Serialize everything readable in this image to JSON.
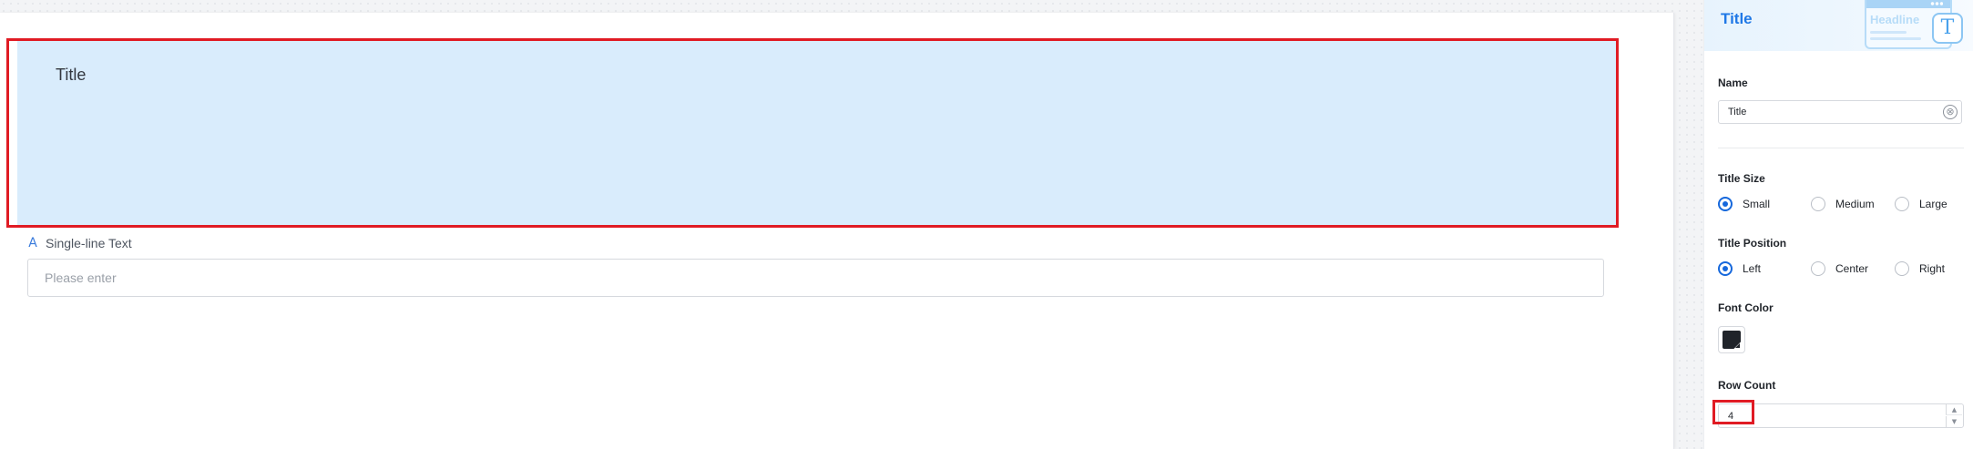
{
  "canvas": {
    "title_block": {
      "text": "Title"
    },
    "field": {
      "type_icon": "A",
      "label": "Single-line Text",
      "placeholder": "Please enter"
    }
  },
  "panel": {
    "header": {
      "title": "Title",
      "illustration_word": "Headline",
      "illustration_glyph": "T"
    },
    "name": {
      "label": "Name",
      "value": "Title",
      "clear_icon": "⊗"
    },
    "title_size": {
      "label": "Title Size",
      "options": [
        "Small",
        "Medium",
        "Large"
      ],
      "selected": "Small"
    },
    "title_position": {
      "label": "Title Position",
      "options": [
        "Left",
        "Center",
        "Right"
      ],
      "selected": "Left"
    },
    "font_color": {
      "label": "Font Color",
      "value": "#1f2329"
    },
    "row_count": {
      "label": "Row Count",
      "value": "4",
      "up": "▲",
      "down": "▼"
    }
  },
  "colors": {
    "accent": "#1668dc",
    "highlight_border": "#e01b24",
    "title_block_fill": "#d9ecfc"
  }
}
